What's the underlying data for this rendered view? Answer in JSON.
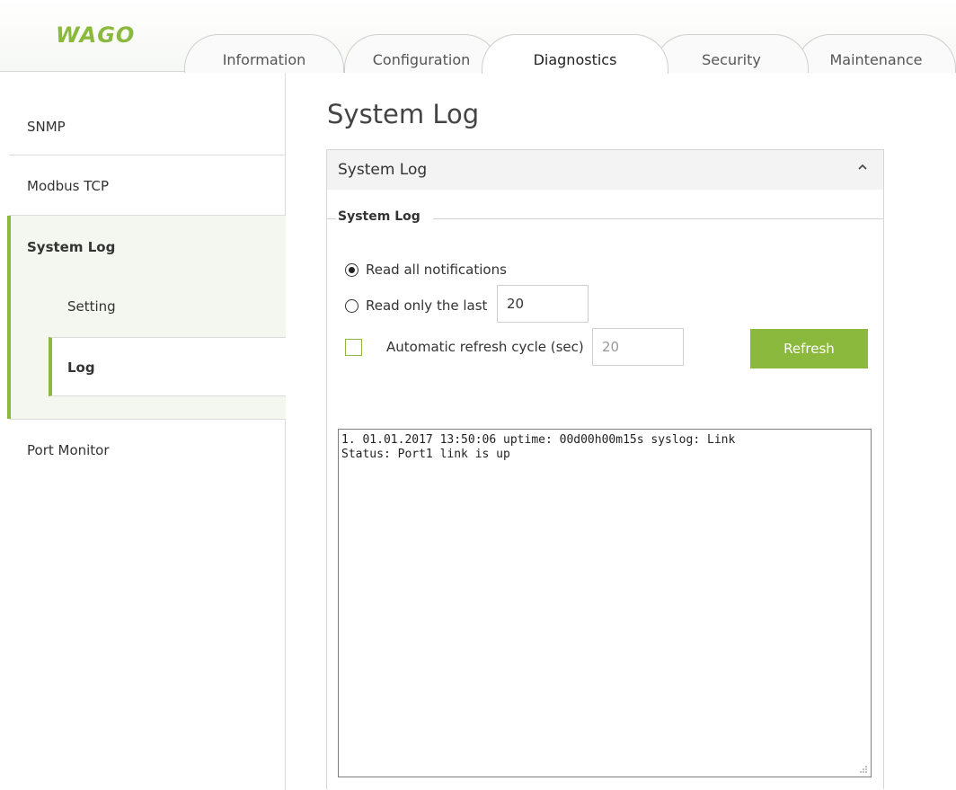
{
  "brand": {
    "logo_text": "WAGO",
    "accent_color": "#8bb93d"
  },
  "tabs": [
    {
      "label": "Information",
      "active": false
    },
    {
      "label": "Configuration",
      "active": false
    },
    {
      "label": "Diagnostics",
      "active": true
    },
    {
      "label": "Security",
      "active": false
    },
    {
      "label": "Maintenance",
      "active": false
    }
  ],
  "sidebar": {
    "items": [
      {
        "label": "SNMP"
      },
      {
        "label": "Modbus TCP"
      },
      {
        "label": "System Log",
        "active": true
      },
      {
        "label": "Setting"
      },
      {
        "label": "Log",
        "active": true
      },
      {
        "label": "Port Monitor"
      }
    ]
  },
  "main": {
    "page_title": "System Log",
    "panel_title": "System Log",
    "collapse_icon": "chevron-up-icon",
    "fieldset_label": "System Log",
    "radio_all_label": "Read all notifications",
    "radio_last_label": "Read only the last",
    "last_count_value": "20",
    "auto_refresh_label": "Automatic refresh cycle (sec)",
    "auto_refresh_value": "20",
    "refresh_button_label": "Refresh",
    "log_text": "1. 01.01.2017 13:50:06 uptime: 00d00h00m15s syslog: Link\nStatus: Port1 link is up"
  }
}
